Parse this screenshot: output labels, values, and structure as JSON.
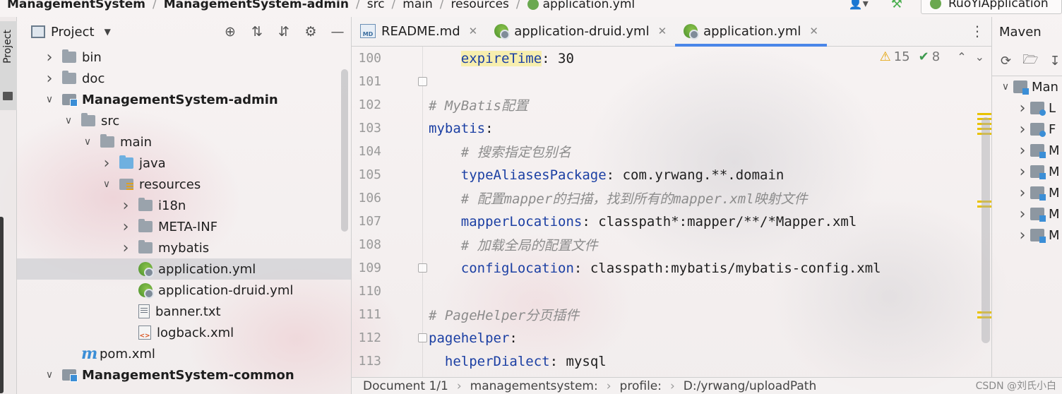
{
  "breadcrumb": {
    "items": [
      "ManagementSystem",
      "ManagementSystem-admin",
      "src",
      "main",
      "resources",
      "application.yml"
    ],
    "run_config": "RuoYiApplication"
  },
  "tool_stripe": {
    "project_label": "Project"
  },
  "project_panel": {
    "title": "Project",
    "tree": [
      {
        "label": "bin",
        "icon": "folder-icon"
      },
      {
        "label": "doc",
        "icon": "folder-icon"
      },
      {
        "label": "ManagementSystem-admin",
        "icon": "module-icon"
      },
      {
        "label": "src",
        "icon": "folder-icon"
      },
      {
        "label": "main",
        "icon": "folder-icon"
      },
      {
        "label": "java",
        "icon": "source-folder-icon"
      },
      {
        "label": "resources",
        "icon": "resources-folder-icon"
      },
      {
        "label": "i18n",
        "icon": "folder-icon"
      },
      {
        "label": "META-INF",
        "icon": "folder-icon"
      },
      {
        "label": "mybatis",
        "icon": "folder-icon"
      },
      {
        "label": "application.yml",
        "icon": "yml-file-icon"
      },
      {
        "label": "application-druid.yml",
        "icon": "yml-file-icon"
      },
      {
        "label": "banner.txt",
        "icon": "text-file-icon"
      },
      {
        "label": "logback.xml",
        "icon": "xml-file-icon"
      },
      {
        "label": "pom.xml",
        "icon": "maven-file-icon"
      },
      {
        "label": "ManagementSystem-common",
        "icon": "module-icon"
      }
    ]
  },
  "editor": {
    "tabs": [
      {
        "label": "README.md"
      },
      {
        "label": "application-druid.yml"
      },
      {
        "label": "application.yml"
      }
    ],
    "inspections": {
      "warnings": "15",
      "weak_warnings": "8"
    },
    "lines": [
      {
        "num": "100",
        "indent": "    ",
        "key": "expireTime",
        "sep": ": ",
        "value": "30"
      },
      {
        "num": "101",
        "indent": "",
        "comment": ""
      },
      {
        "num": "102",
        "indent": "",
        "comment": "# MyBatis配置"
      },
      {
        "num": "103",
        "indent": "",
        "key": "mybatis",
        "sep": ":",
        "value": ""
      },
      {
        "num": "104",
        "indent": "    ",
        "comment": "# 搜索指定包别名"
      },
      {
        "num": "105",
        "indent": "    ",
        "key": "typeAliasesPackage",
        "sep": ": ",
        "value": "com.yrwang.**.domain"
      },
      {
        "num": "106",
        "indent": "    ",
        "comment": "# 配置mapper的扫描，找到所有的mapper.xml映射文件"
      },
      {
        "num": "107",
        "indent": "    ",
        "key": "mapperLocations",
        "sep": ": ",
        "value": "classpath*:mapper/**/*Mapper.xml"
      },
      {
        "num": "108",
        "indent": "    ",
        "comment": "# 加载全局的配置文件"
      },
      {
        "num": "109",
        "indent": "    ",
        "key": "configLocation",
        "sep": ": ",
        "value": "classpath:mybatis/mybatis-config.xml"
      },
      {
        "num": "110",
        "indent": "",
        "comment": ""
      },
      {
        "num": "111",
        "indent": "",
        "comment": "# PageHelper分页插件"
      },
      {
        "num": "112",
        "indent": "",
        "key": "pagehelper",
        "sep": ":",
        "value": ""
      },
      {
        "num": "113",
        "indent": "  ",
        "key": "helperDialect",
        "sep": ": ",
        "value": "mysql"
      }
    ]
  },
  "maven_panel": {
    "title": "Maven",
    "items": [
      "Man",
      "L",
      "F",
      "M",
      "M",
      "M",
      "M",
      "M"
    ]
  },
  "statusbar": {
    "crumbs": [
      "Document 1/1",
      "managementsystem:",
      "profile:",
      "D:/yrwang/uploadPath"
    ],
    "watermark": "CSDN @刘氏小白"
  },
  "colors": {
    "key": "#1b3fa3",
    "comment": "#8c8c8c",
    "accent": "#4a86e8",
    "spring_green": "#6aa84f"
  }
}
